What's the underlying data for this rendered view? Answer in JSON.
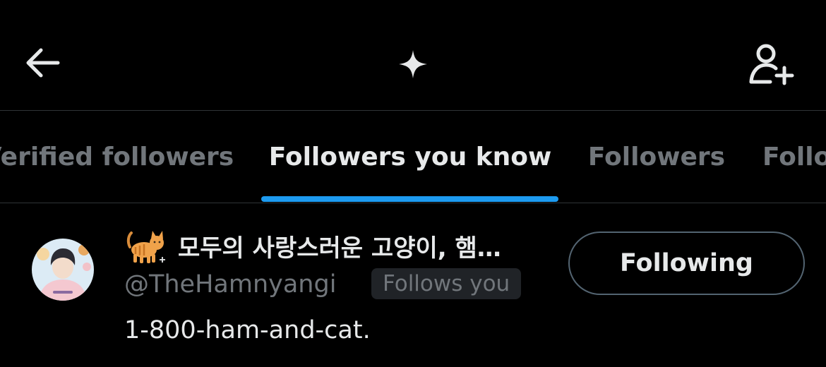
{
  "header": {
    "back_icon": "arrow-left-icon",
    "center_icon": "sparkle-icon",
    "right_icon": "add-user-icon"
  },
  "tabs": [
    {
      "label": "Verified followers",
      "active": false
    },
    {
      "label": "Followers you know",
      "active": true
    },
    {
      "label": "Followers",
      "active": false
    },
    {
      "label": "Following",
      "active": false
    }
  ],
  "user": {
    "avatar_icon": "avatar",
    "emoji": "cat-emoji",
    "display_name": "모두의 사랑스러운 고양이, 햄…",
    "handle": "@TheHamnyangi",
    "follows_you": "Follows you",
    "bio": "1-800-ham-and-cat.",
    "follow_button": "Following"
  },
  "colors": {
    "background": "#000000",
    "text_primary": "#e7e9ea",
    "text_secondary": "#71767b",
    "accent": "#1d9bf0",
    "divider": "#2f3336",
    "badge_bg": "#202327"
  }
}
